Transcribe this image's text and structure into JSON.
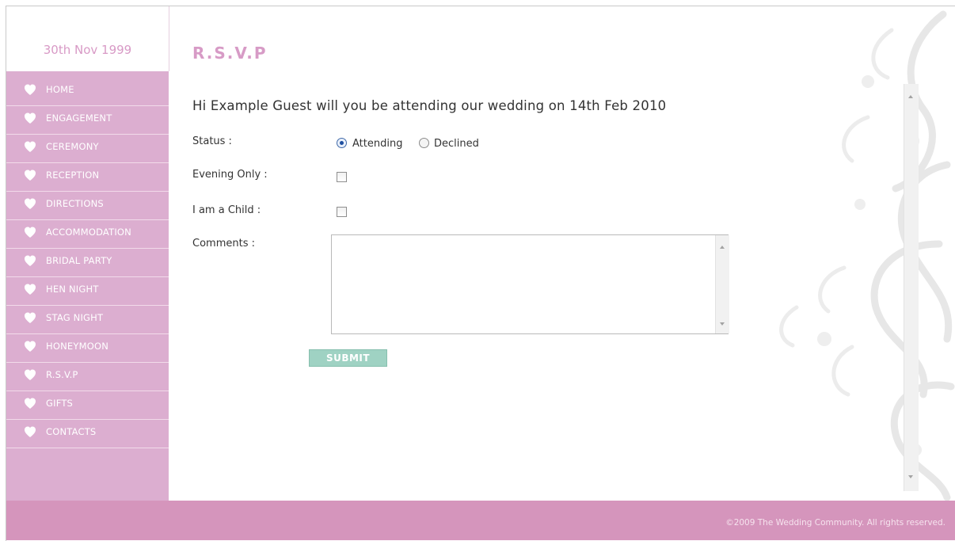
{
  "sidebar": {
    "date": "30th Nov 1999",
    "items": [
      {
        "label": "HOME"
      },
      {
        "label": "ENGAGEMENT"
      },
      {
        "label": "CEREMONY"
      },
      {
        "label": "RECEPTION"
      },
      {
        "label": "DIRECTIONS"
      },
      {
        "label": "ACCOMMODATION"
      },
      {
        "label": "BRIDAL PARTY"
      },
      {
        "label": "HEN NIGHT"
      },
      {
        "label": "STAG NIGHT"
      },
      {
        "label": "HONEYMOON"
      },
      {
        "label": "R.S.V.P"
      },
      {
        "label": "GIFTS"
      },
      {
        "label": "CONTACTS"
      }
    ],
    "item_icon": "heart-icon"
  },
  "main": {
    "title": "R.S.V.P",
    "intro": "Hi Example Guest will you be attending our wedding on 14th Feb 2010",
    "form": {
      "status_label": "Status :",
      "status_options": [
        {
          "label": "Attending",
          "checked": true
        },
        {
          "label": "Declined",
          "checked": false
        }
      ],
      "evening_label": "Evening Only :",
      "evening_checked": false,
      "child_label": "I am a Child :",
      "child_checked": false,
      "comments_label": "Comments :",
      "comments_value": "",
      "submit_label": "SUBMIT"
    }
  },
  "footer": {
    "text": "©2009 The Wedding Community. All rights reserved."
  },
  "colors": {
    "sidebar_bg": "#dcaed0",
    "accent_pink": "#d79bc6",
    "footer_bg": "#d595bc",
    "submit_bg": "#9fd2c3"
  }
}
